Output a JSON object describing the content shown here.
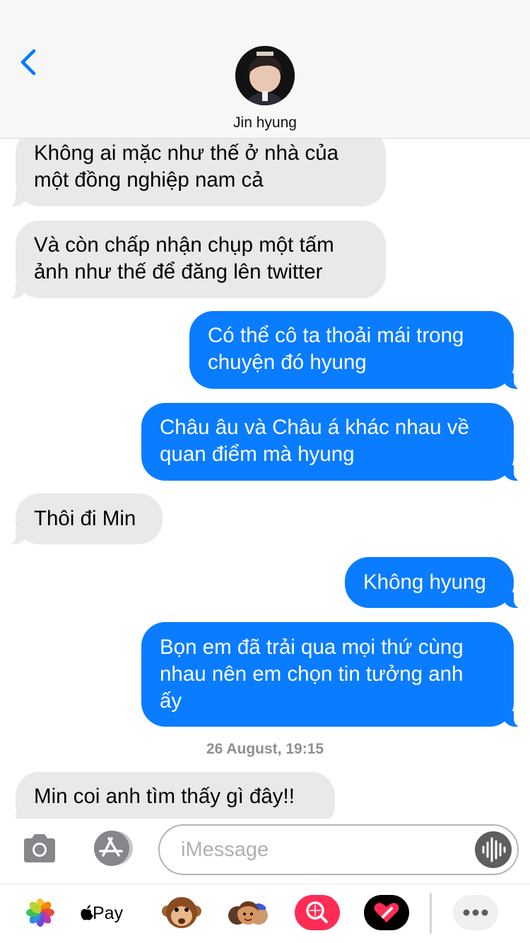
{
  "header": {
    "contact_name": "Jin hyung",
    "back_icon": "chevron-left-icon",
    "avatar": "contact-avatar"
  },
  "messages": [
    {
      "direction": "incoming",
      "text": "Không ai mặc như thế ở nhà của\nmột đồng nghiệp nam cả"
    },
    {
      "direction": "incoming",
      "text": "Và còn chấp nhận chụp một tấm\nảnh như thế để đăng lên twitter"
    },
    {
      "direction": "outgoing",
      "text": "Có thể cô ta thoải mái trong\nchuyện đó hyung"
    },
    {
      "direction": "outgoing",
      "text": "Châu âu và Châu á khác nhau về\nquan điểm mà hyung"
    },
    {
      "direction": "incoming",
      "text": "Thôi đi Min"
    },
    {
      "direction": "outgoing",
      "text": "Không hyung"
    },
    {
      "direction": "outgoing",
      "text": "Bọn em đã trải qua mọi thứ cùng\nnhau nên em chọn tin tưởng anh\nấy"
    },
    {
      "direction": "incoming",
      "text": "Min coi anh tìm thấy gì đây!!"
    }
  ],
  "timestamp": "26 August, 19:15",
  "input_bar": {
    "placeholder": "iMessage",
    "camera_icon": "camera-icon",
    "apps_icon": "app-store-icon",
    "audio_icon": "audio-waveform-icon"
  },
  "app_tray": {
    "apple_pay_label": "Pay",
    "items": [
      "photos-icon",
      "apple-pay-icon",
      "monkey-animoji-icon",
      "memoji-icon",
      "search-images-icon",
      "digital-touch-icon",
      "more-icon"
    ]
  },
  "colors": {
    "outgoing_bubble": "#0a7cff",
    "incoming_bubble": "#e9e9eb",
    "accent": "#007aff",
    "battery": "#4cd964"
  }
}
